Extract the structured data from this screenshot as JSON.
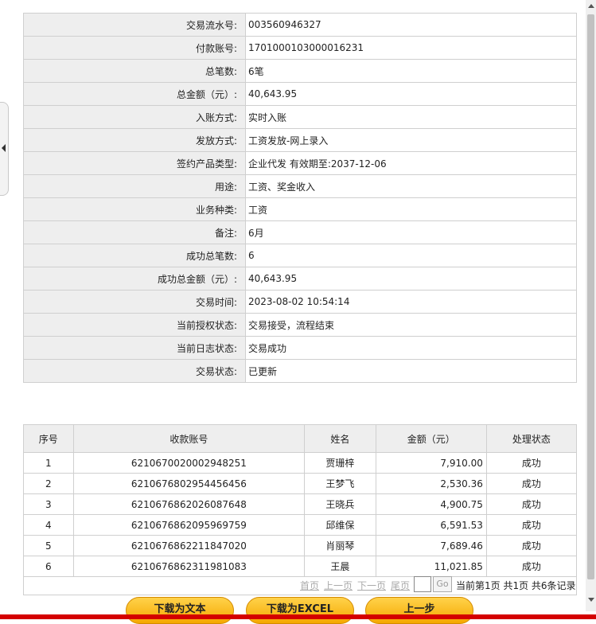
{
  "detail": [
    {
      "label": "交易流水号:",
      "value": "003560946327"
    },
    {
      "label": "付款账号:",
      "value": "1701000103000016231"
    },
    {
      "label": "总笔数:",
      "value": "6笔"
    },
    {
      "label": "总金额（元）:",
      "value": "40,643.95"
    },
    {
      "label": "入账方式:",
      "value": "实时入账"
    },
    {
      "label": "发放方式:",
      "value": "工资发放-网上录入"
    },
    {
      "label": "签约产品类型:",
      "value": "企业代发 有效期至:2037-12-06"
    },
    {
      "label": "用途:",
      "value": "工资、奖金收入"
    },
    {
      "label": "业务种类:",
      "value": "工资"
    },
    {
      "label": "备注:",
      "value": "6月"
    },
    {
      "label": "成功总笔数:",
      "value": "6"
    },
    {
      "label": "成功总金额（元）:",
      "value": "40,643.95"
    },
    {
      "label": "交易时间:",
      "value": "2023-08-02 10:54:14"
    },
    {
      "label": "当前授权状态:",
      "value": "交易接受，流程结束"
    },
    {
      "label": "当前日志状态:",
      "value": "交易成功"
    },
    {
      "label": "交易状态:",
      "value": "已更新"
    }
  ],
  "records": {
    "headers": [
      "序号",
      "收款账号",
      "姓名",
      "金额（元）",
      "处理状态"
    ],
    "rows": [
      [
        "1",
        "6210670020002948251",
        "贾珊梓",
        "7,910.00",
        "成功"
      ],
      [
        "2",
        "6210676802954456456",
        "王梦飞",
        "2,530.36",
        "成功"
      ],
      [
        "3",
        "6210676862026087648",
        "王晓兵",
        "4,900.75",
        "成功"
      ],
      [
        "4",
        "6210676862095969759",
        "邱维保",
        "6,591.53",
        "成功"
      ],
      [
        "5",
        "6210676862211847020",
        "肖丽琴",
        "7,689.46",
        "成功"
      ],
      [
        "6",
        "6210676862311981083",
        "王晨",
        "11,021.85",
        "成功"
      ]
    ]
  },
  "pager": {
    "first": "首页",
    "prev": "上一页",
    "next": "下一页",
    "last": "尾页",
    "go": "Go",
    "info": "当前第1页 共1页 共6条记录"
  },
  "buttons": {
    "download_text": "下载为文本",
    "download_excel": "下载为EXCEL",
    "back": "上一步"
  },
  "colors": {
    "label_bg": "#eeeeee",
    "button_gradient_top": "#ffd24a",
    "button_gradient_bottom": "#f5a800",
    "bottom_bar": "#d40000"
  }
}
